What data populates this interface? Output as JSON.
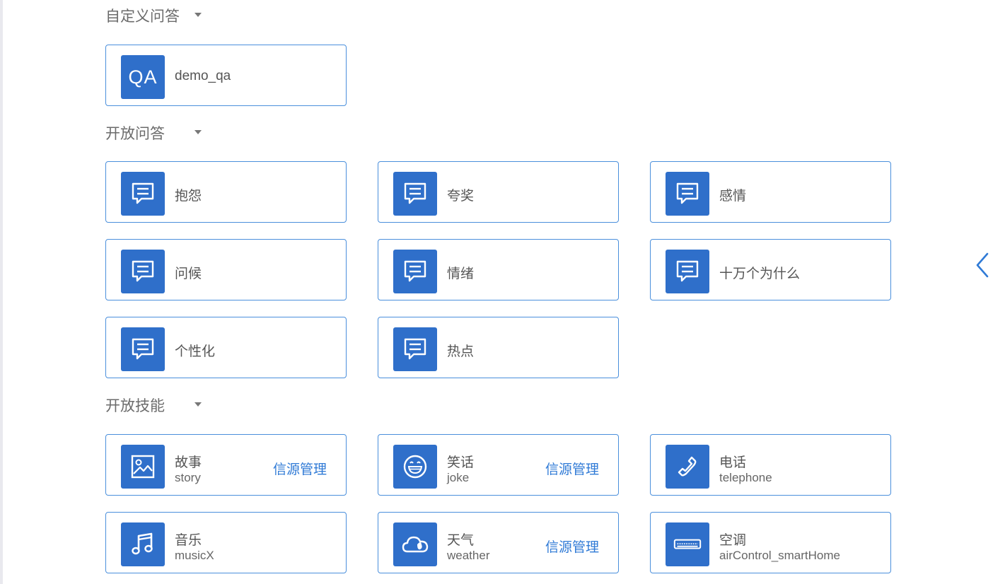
{
  "colors": {
    "accent": "#2f6fca",
    "border": "#4a8fdc",
    "link": "#2f7ad6"
  },
  "sections": {
    "custom": {
      "title": "自定义问答",
      "cards": [
        {
          "label": "demo_qa",
          "icon": "qa-text-icon",
          "icon_text": "QA"
        }
      ]
    },
    "open_qa": {
      "title": "开放问答",
      "cards": [
        {
          "label": "抱怨",
          "icon": "chat-bubble-icon"
        },
        {
          "label": "夸奖",
          "icon": "chat-bubble-icon"
        },
        {
          "label": "感情",
          "icon": "chat-bubble-icon"
        },
        {
          "label": "问候",
          "icon": "chat-bubble-icon"
        },
        {
          "label": "情绪",
          "icon": "chat-bubble-icon"
        },
        {
          "label": "十万个为什么",
          "icon": "chat-bubble-icon"
        },
        {
          "label": "个性化",
          "icon": "chat-bubble-icon"
        },
        {
          "label": "热点",
          "icon": "chat-bubble-icon"
        }
      ]
    },
    "skills": {
      "title": "开放技能",
      "cards": [
        {
          "name": "故事",
          "sub": "story",
          "link": "信源管理",
          "icon": "picture-icon"
        },
        {
          "name": "笑话",
          "sub": "joke",
          "link": "信源管理",
          "icon": "smile-icon"
        },
        {
          "name": "电话",
          "sub": "telephone",
          "icon": "phone-icon"
        },
        {
          "name": "音乐",
          "sub": "musicX",
          "icon": "music-note-icon"
        },
        {
          "name": "天气",
          "sub": "weather",
          "link": "信源管理",
          "icon": "cloud-icon"
        },
        {
          "name": "空调",
          "sub": "airControl_smartHome",
          "icon": "air-conditioner-icon"
        }
      ]
    }
  },
  "nav": {
    "collapse_icon": "chevron-left-icon"
  }
}
